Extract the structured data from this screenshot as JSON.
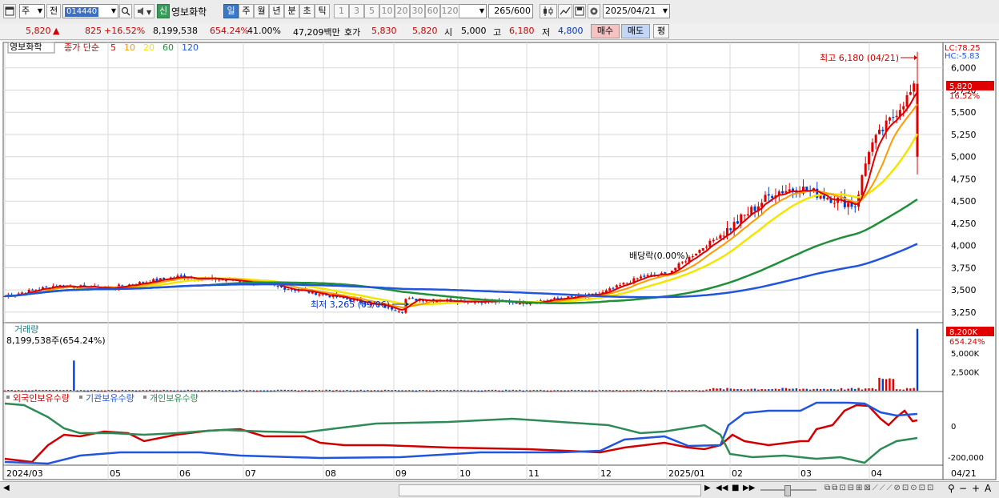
{
  "toolbar": {
    "market": "주",
    "scope": "전",
    "code": "014440",
    "badge": "신",
    "name": "영보화학",
    "periods": [
      "일",
      "주",
      "월",
      "년",
      "분",
      "초",
      "틱"
    ],
    "selected_period": "일",
    "minutes": [
      "1",
      "3",
      "5",
      "10",
      "20",
      "30",
      "60",
      "120"
    ],
    "count": "265",
    "count_max": "/600",
    "date": "2025/04/21"
  },
  "quote": {
    "price": "5,820",
    "arrow": "▲",
    "change": "825",
    "change_pct": "+16.52%",
    "volume": "8,199,538",
    "volume_ratio": "654.24%",
    "turnover": "41.00%",
    "amount": "47,209백만",
    "hoga_label": "호가",
    "ask": "5,830",
    "bid": "5,820",
    "open_label": "시",
    "open": "5,000",
    "high_label": "고",
    "high": "6,180",
    "low_label": "저",
    "low": "4,800",
    "buy_label": "매수",
    "sell_label": "매도",
    "eval_label": "평"
  },
  "price_panel": {
    "title": "영보화학",
    "ma_label": "종가 단순",
    "ma_periods": [
      "5",
      "10",
      "20",
      "60",
      "120"
    ],
    "ma_colors": [
      "#dd0000",
      "#ff9900",
      "#f2e600",
      "#1f8f3a",
      "#2255dd"
    ],
    "lc": "LC:78.25",
    "hc": "HC:-5.83",
    "last_price": "5,820",
    "last_pct": "16.52%",
    "high_annotation": "최고 6,180 (04/21)",
    "low_annotation": "최저 3,265 (09/06)",
    "dividend_annotation": "배당락(0.00%)",
    "y_ticks": [
      "6,000",
      "5,750",
      "5,500",
      "5,250",
      "5,000",
      "4,750",
      "4,500",
      "4,250",
      "4,000",
      "3,750",
      "3,500",
      "3,250"
    ]
  },
  "volume_panel": {
    "title": "거래량",
    "value": "8,199,538주(654.24%)",
    "last": "8,200K",
    "last_pct": "654.24%",
    "y_ticks": [
      "5,000K",
      "2,500K"
    ]
  },
  "flow_panel": {
    "legend": [
      {
        "label": "외국인보유수량",
        "color": "#d00000"
      },
      {
        "label": "기관보유수량",
        "color": "#2255dd"
      },
      {
        "label": "개인보유수량",
        "color": "#2e8b57"
      }
    ],
    "y_ticks": [
      "0",
      "-200,000"
    ]
  },
  "x_axis": {
    "labels": [
      "2024/03",
      "05",
      "06",
      "07",
      "08",
      "09",
      "10",
      "11",
      "12",
      "2025/01",
      "02",
      "03",
      "04"
    ],
    "last_label": "04/21"
  },
  "chart_data": {
    "type": "candlestick",
    "x_range": [
      "2024/03",
      "2025/04/21"
    ],
    "ylim": [
      3150,
      6250
    ],
    "price_checkpoints": [
      {
        "date": "2024/03",
        "close": 3430
      },
      {
        "date": "2024/04",
        "close": 3550
      },
      {
        "date": "2024/05",
        "close": 3520
      },
      {
        "date": "2024/06",
        "close": 3650
      },
      {
        "date": "2024/07",
        "close": 3600
      },
      {
        "date": "2024/08",
        "close": 3450
      },
      {
        "date": "2024/09/06",
        "close": 3265
      },
      {
        "date": "2024/09",
        "close": 3400
      },
      {
        "date": "2024/10",
        "close": 3380
      },
      {
        "date": "2024/11",
        "close": 3360
      },
      {
        "date": "2024/12",
        "close": 3450
      },
      {
        "date": "2024/12/20",
        "close": 3650
      },
      {
        "date": "2025/01",
        "close": 3680
      },
      {
        "date": "2025/02",
        "close": 4200
      },
      {
        "date": "2025/02/20",
        "close": 4600
      },
      {
        "date": "2025/03",
        "close": 4650
      },
      {
        "date": "2025/03/25",
        "close": 4450
      },
      {
        "date": "2025/04",
        "close": 5100
      },
      {
        "date": "2025/04/21",
        "close": 5820
      }
    ],
    "last_candle": {
      "date": "2025/04/21",
      "open": 5000,
      "high": 6180,
      "low": 4800,
      "close": 5820
    },
    "ma_endpoints": {
      "ma60": 4520,
      "ma120": 4020
    },
    "volume_last": 8199538
  }
}
